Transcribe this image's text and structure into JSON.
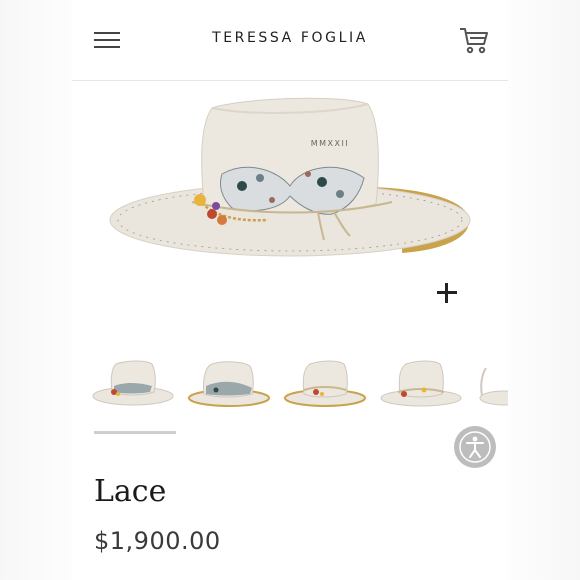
{
  "header": {
    "brand": "TERESSA FOGLIA",
    "menu_icon": "hamburger-menu-icon",
    "cart_icon": "shopping-cart-icon"
  },
  "gallery": {
    "hat_print": "MMXXII",
    "zoom_icon": "plus-icon",
    "thumbnails": [
      "front",
      "back",
      "side-left",
      "side-right"
    ]
  },
  "product": {
    "title": "Lace",
    "price": "$1,900.00"
  },
  "accessibility_icon": "accessibility-icon",
  "colors": {
    "felt": "#e8e2d9",
    "gold": "#c9a24a",
    "text": "#1b1b1b"
  }
}
